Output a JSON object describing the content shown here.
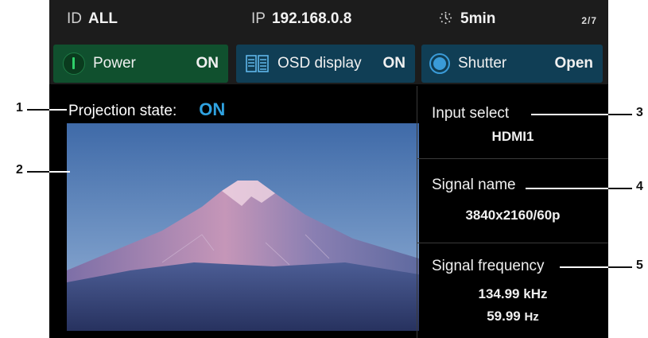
{
  "header": {
    "id_label": "ID",
    "id_value": "ALL",
    "ip_label": "IP",
    "ip_value": "192.168.0.8",
    "timer_icon": "timer-icon",
    "timer_value": "5min",
    "page": "2/7"
  },
  "buttons": {
    "power": {
      "label": "Power",
      "value": "ON",
      "icon": "power-icon",
      "color": "#10502e"
    },
    "osd": {
      "label": "OSD display",
      "value": "ON",
      "icon": "osd-icon",
      "color": "#103e55"
    },
    "shutter": {
      "label": "Shutter",
      "value": "Open",
      "icon": "shutter-icon",
      "color": "#103e55"
    }
  },
  "projection": {
    "label": "Projection state:",
    "value": "ON",
    "value_color": "#2fa2e0"
  },
  "input_select": {
    "label": "Input select",
    "value": "HDMI1"
  },
  "signal_name": {
    "label": "Signal name",
    "value": "3840x2160/60p"
  },
  "signal_frequency": {
    "label": "Signal frequency",
    "h_value": "134.99 kHz",
    "v_value": "59.99",
    "v_unit": "Hz"
  },
  "callouts": [
    "1",
    "2",
    "3",
    "4",
    "5"
  ]
}
